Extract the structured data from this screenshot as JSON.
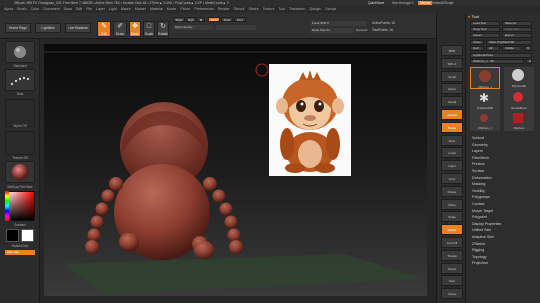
{
  "titlebar": "ZBrush 4R6 P2   Orangutan_001   Free Mem 7.486GB • Active Mem 784 • Scratch Disk 48 • ZTime▲ 2.095 • PolyCount▲ 3 KP • MeshCount▲ 0",
  "quicksave": "QuickSave",
  "seethrough": "See-through 0",
  "menus_label": "Menus",
  "default_zscript": "DefaultZScript",
  "menus": [
    "Alpha",
    "Brush",
    "Color",
    "Document",
    "Draw",
    "Edit",
    "File",
    "Layer",
    "Light",
    "Macro",
    "Marker",
    "Material",
    "Movie",
    "Picker",
    "Preferences",
    "Render",
    "Stencil",
    "Stroke",
    "Texture",
    "Tool",
    "Transform",
    "Zplugin",
    "Zscript"
  ],
  "shelf": {
    "home_page": "Home Page",
    "lightbox": "LightBox",
    "live_boolean": "Live Boolean",
    "edit": "Edit",
    "draw": "Draw",
    "move": "Move",
    "scale": "Scale",
    "rotate": "Rotate",
    "mrgb": "Mrgb",
    "rgb": "Rgb",
    "m": "M",
    "zadd": "Zadd",
    "zsub": "Zsub",
    "zcut": "Zcut",
    "rgb_intensity": "Rgb Intensity",
    "focal_shift": "Focal Shift 0",
    "draw_size": "Draw Size 64",
    "dynamic": "Dynamic",
    "active_points": "ActivePoints: 16",
    "total_points": "TotalPoints: 16"
  },
  "left_tray": {
    "standard_label": "Standard",
    "dots_label": "Dots",
    "alpha_off": "Alpha Off",
    "texture_off": "Texture Off",
    "matcap": "MatCap Red Wax",
    "gradient": "Gradient",
    "switch_color": "SwitchColor",
    "alternate": "Alternate"
  },
  "right_tray": [
    "BPR",
    "SPix 3",
    "Scroll",
    "Zoom",
    "Actual",
    "AAHalf",
    "Persp",
    "Floor",
    "Local",
    "LSym",
    "Gxyz",
    "Frame",
    "Move",
    "Scale",
    "Rotate",
    "Line Fill",
    "Transp",
    "Ghost",
    "Solo",
    "Xpose"
  ],
  "tool_panel": {
    "title": "Tool",
    "load_tool": "Load Tool",
    "save_as": "Save As",
    "copy_tool": "Copy Tool",
    "paste_tool": "Paste Tool",
    "import": "Import",
    "export": "Export",
    "clone": "Clone",
    "make_polymesh": "Make PolyMesh3D",
    "goz": "GoZ",
    "all": "All",
    "visible": "Visible",
    "r": "R",
    "lightbox_tools": "Lightbox▸Tools",
    "current_tool": "ZSphere_1 . 86",
    "r2": "R",
    "thumbs": [
      "ZSphere_1",
      "ZSphere3D",
      "PolyMesh3D",
      "SimpleBrush",
      "ZSphere",
      "ZSphere_1"
    ],
    "sections": [
      "Subtool",
      "Geometry",
      "Layers",
      "FiberMesh",
      "Preview",
      "Surface",
      "Deformation",
      "Masking",
      "Visibility",
      "Polygroups",
      "Contact",
      "Morph Target",
      "Polypaint",
      "Display Properties",
      "Unified Skin",
      "Adaptive Skin",
      "ZSketch",
      "Rigging",
      "Topology",
      "Projection"
    ]
  },
  "colors": {
    "accent": "#e8821e",
    "orangutan_fur": "#b8561e",
    "sphere_red": "#8a3c2e"
  }
}
